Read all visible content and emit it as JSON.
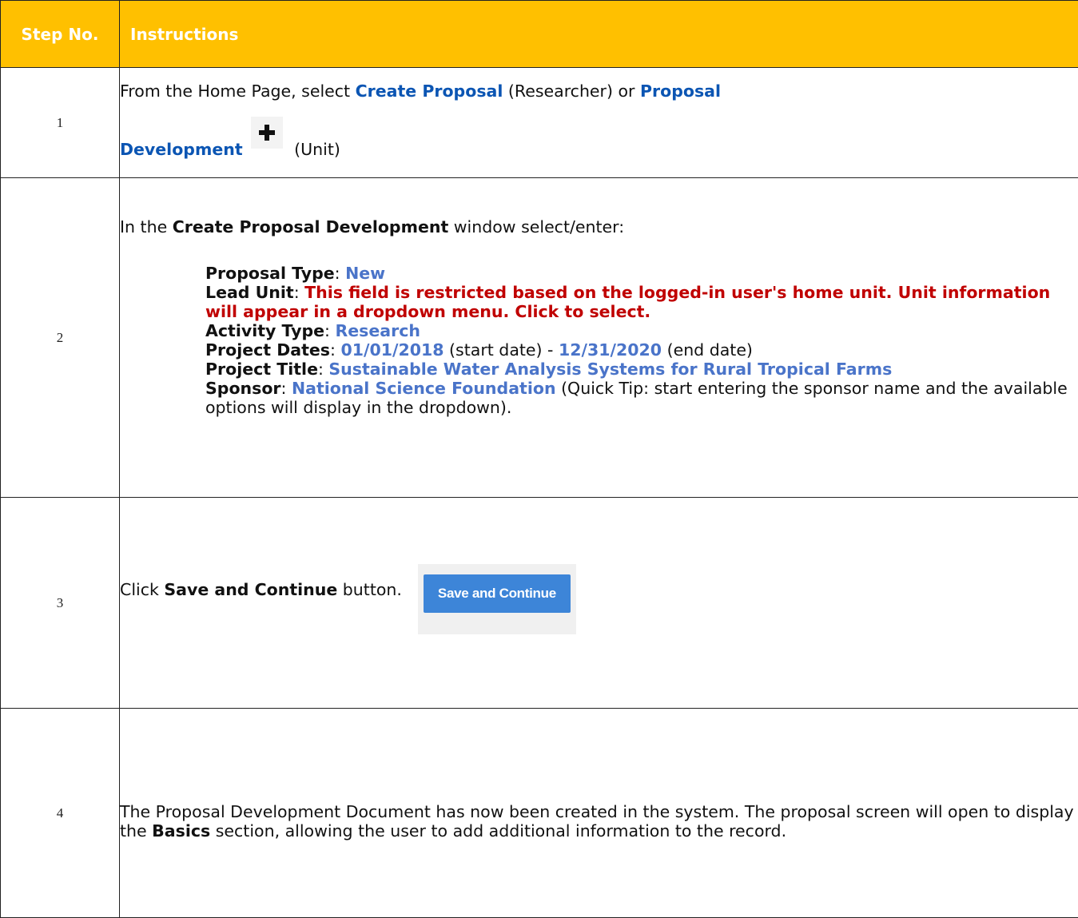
{
  "header": {
    "step_no": "Step No.",
    "instructions": "Instructions"
  },
  "steps": [
    {
      "num": "1",
      "t1": "From the Home Page, select ",
      "link1": "Create Proposal",
      "t2": " (Researcher) or ",
      "link2a": "Proposal",
      "link2b": "Development",
      "icon": "plus-icon",
      "t3": " (Unit)"
    },
    {
      "num": "2",
      "intro_pre": "In the ",
      "intro_bold": "Create Proposal Development",
      "intro_post": " window select/enter:",
      "proposal_type_label": "Proposal Type",
      "proposal_type_value": "New",
      "lead_unit_label": "Lead Unit",
      "lead_unit_value": "This field is restricted based on the logged-in user's home unit. Unit information will appear in a dropdown menu. Click to select.",
      "activity_type_label": "Activity Type",
      "activity_type_value": "Research",
      "project_dates_label": "Project Dates",
      "start_date": "01/01/2018",
      "start_note": " (start date) - ",
      "end_date": "12/31/2020",
      "end_note": " (end date)",
      "project_title_label": "Project Title",
      "project_title_value": "Sustainable Water Analysis Systems for Rural Tropical Farms",
      "sponsor_label": "Sponsor",
      "sponsor_value": "National Science Foundation",
      "sponsor_tip": " (Quick Tip: start entering the sponsor name and the available options will display in the dropdown)."
    },
    {
      "num": "3",
      "pre": "Click ",
      "bold": "Save and Continue",
      "post": " button.",
      "button_label": "Save and Continue"
    },
    {
      "num": "4",
      "pre": "The Proposal Development Document has now been created in the system.  The proposal screen will open to display the ",
      "bold": "Basics",
      "post": " section, allowing the user to add additional information to the record."
    }
  ],
  "colors": {
    "header_bg": "#FFC000",
    "link_blue": "#0b55b3",
    "value_blue": "#4a74c9",
    "warning_red": "#c00000",
    "button_blue": "#3d85d8"
  }
}
